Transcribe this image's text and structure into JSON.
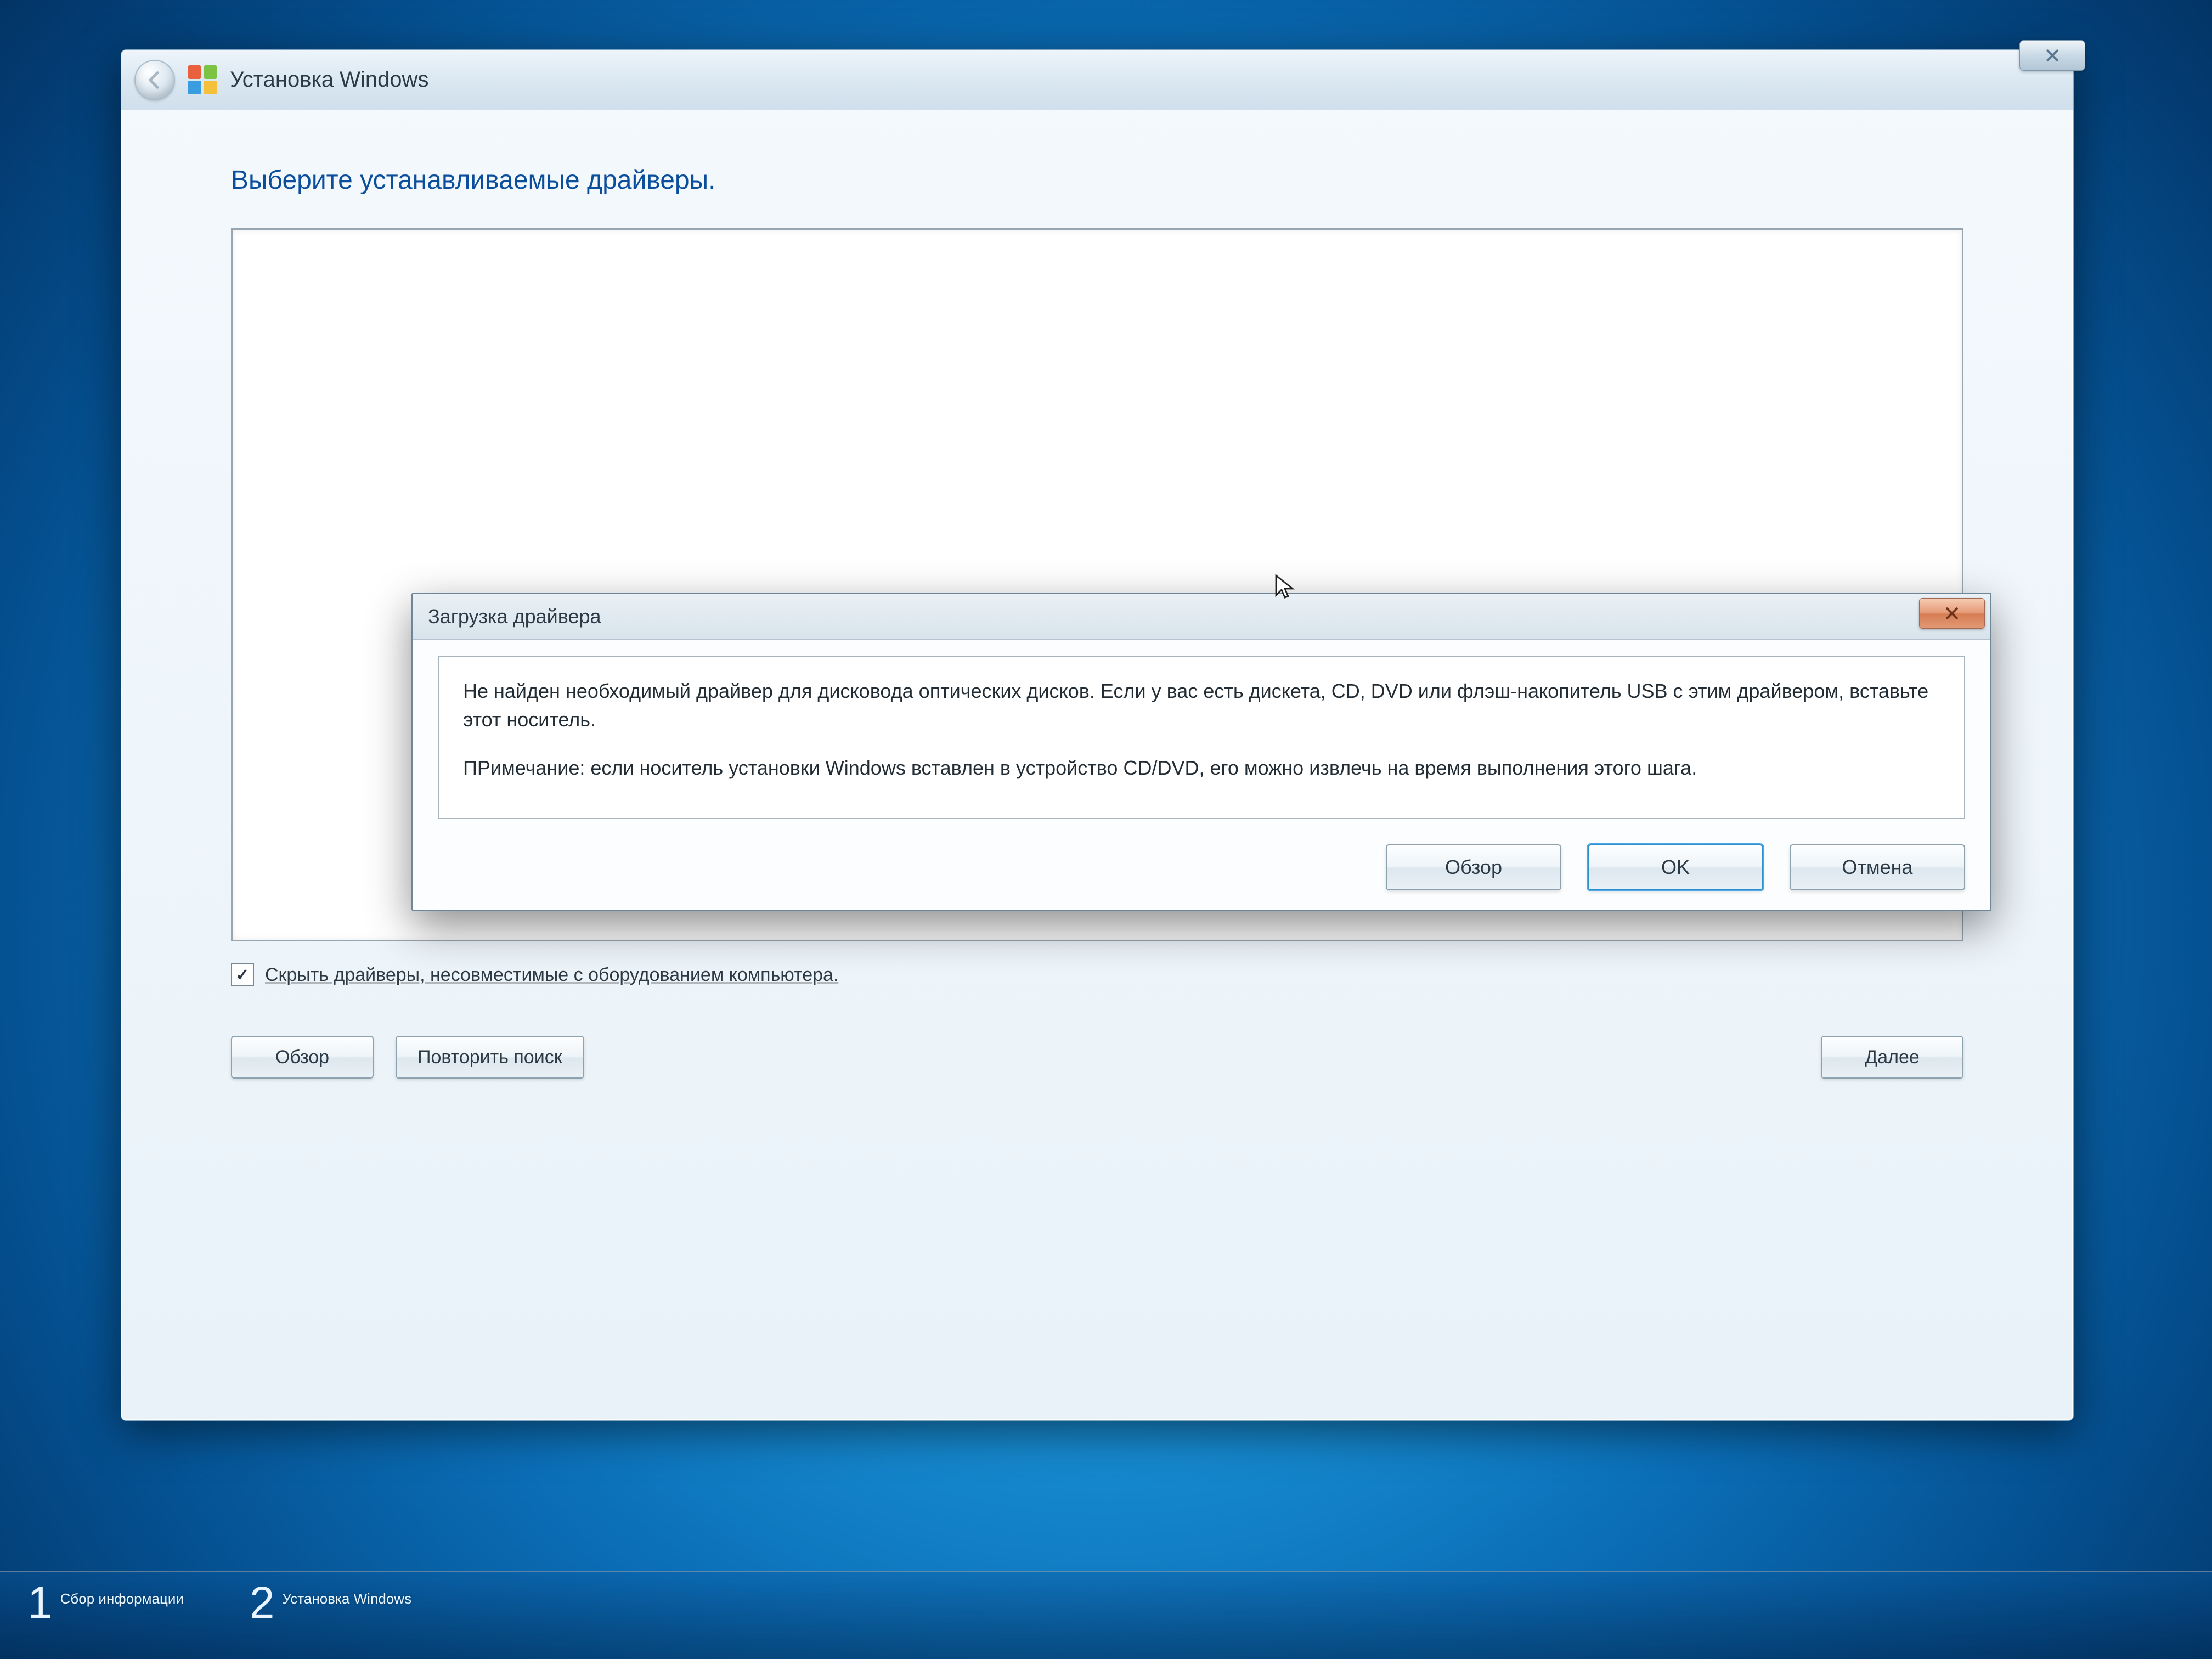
{
  "window": {
    "title": "Установка Windows",
    "heading": "Выберите устанавливаемые драйверы.",
    "hide_incompatible_label": "Скрыть драйверы, несовместимые с оборудованием компьютера.",
    "browse_label": "Обзор",
    "rescan_label": "Повторить поиск",
    "next_label": "Далее"
  },
  "dialog": {
    "title": "Загрузка драйвера",
    "message_p1": "Не найден необходимый драйвер для дисковода оптических дисков. Если у вас есть дискета, CD, DVD или флэш-накопитель USB с этим драйвером, вставьте этот носитель.",
    "message_p2": "ПРимечание: если носитель установки Windows вставлен в устройство CD/DVD, его можно извлечь на время выполнения этого шага.",
    "browse_label": "Обзор",
    "ok_label": "OK",
    "cancel_label": "Отмена"
  },
  "steps": {
    "step1_num": "1",
    "step1_label": "Сбор информации",
    "step2_num": "2",
    "step2_label": "Установка Windows"
  }
}
